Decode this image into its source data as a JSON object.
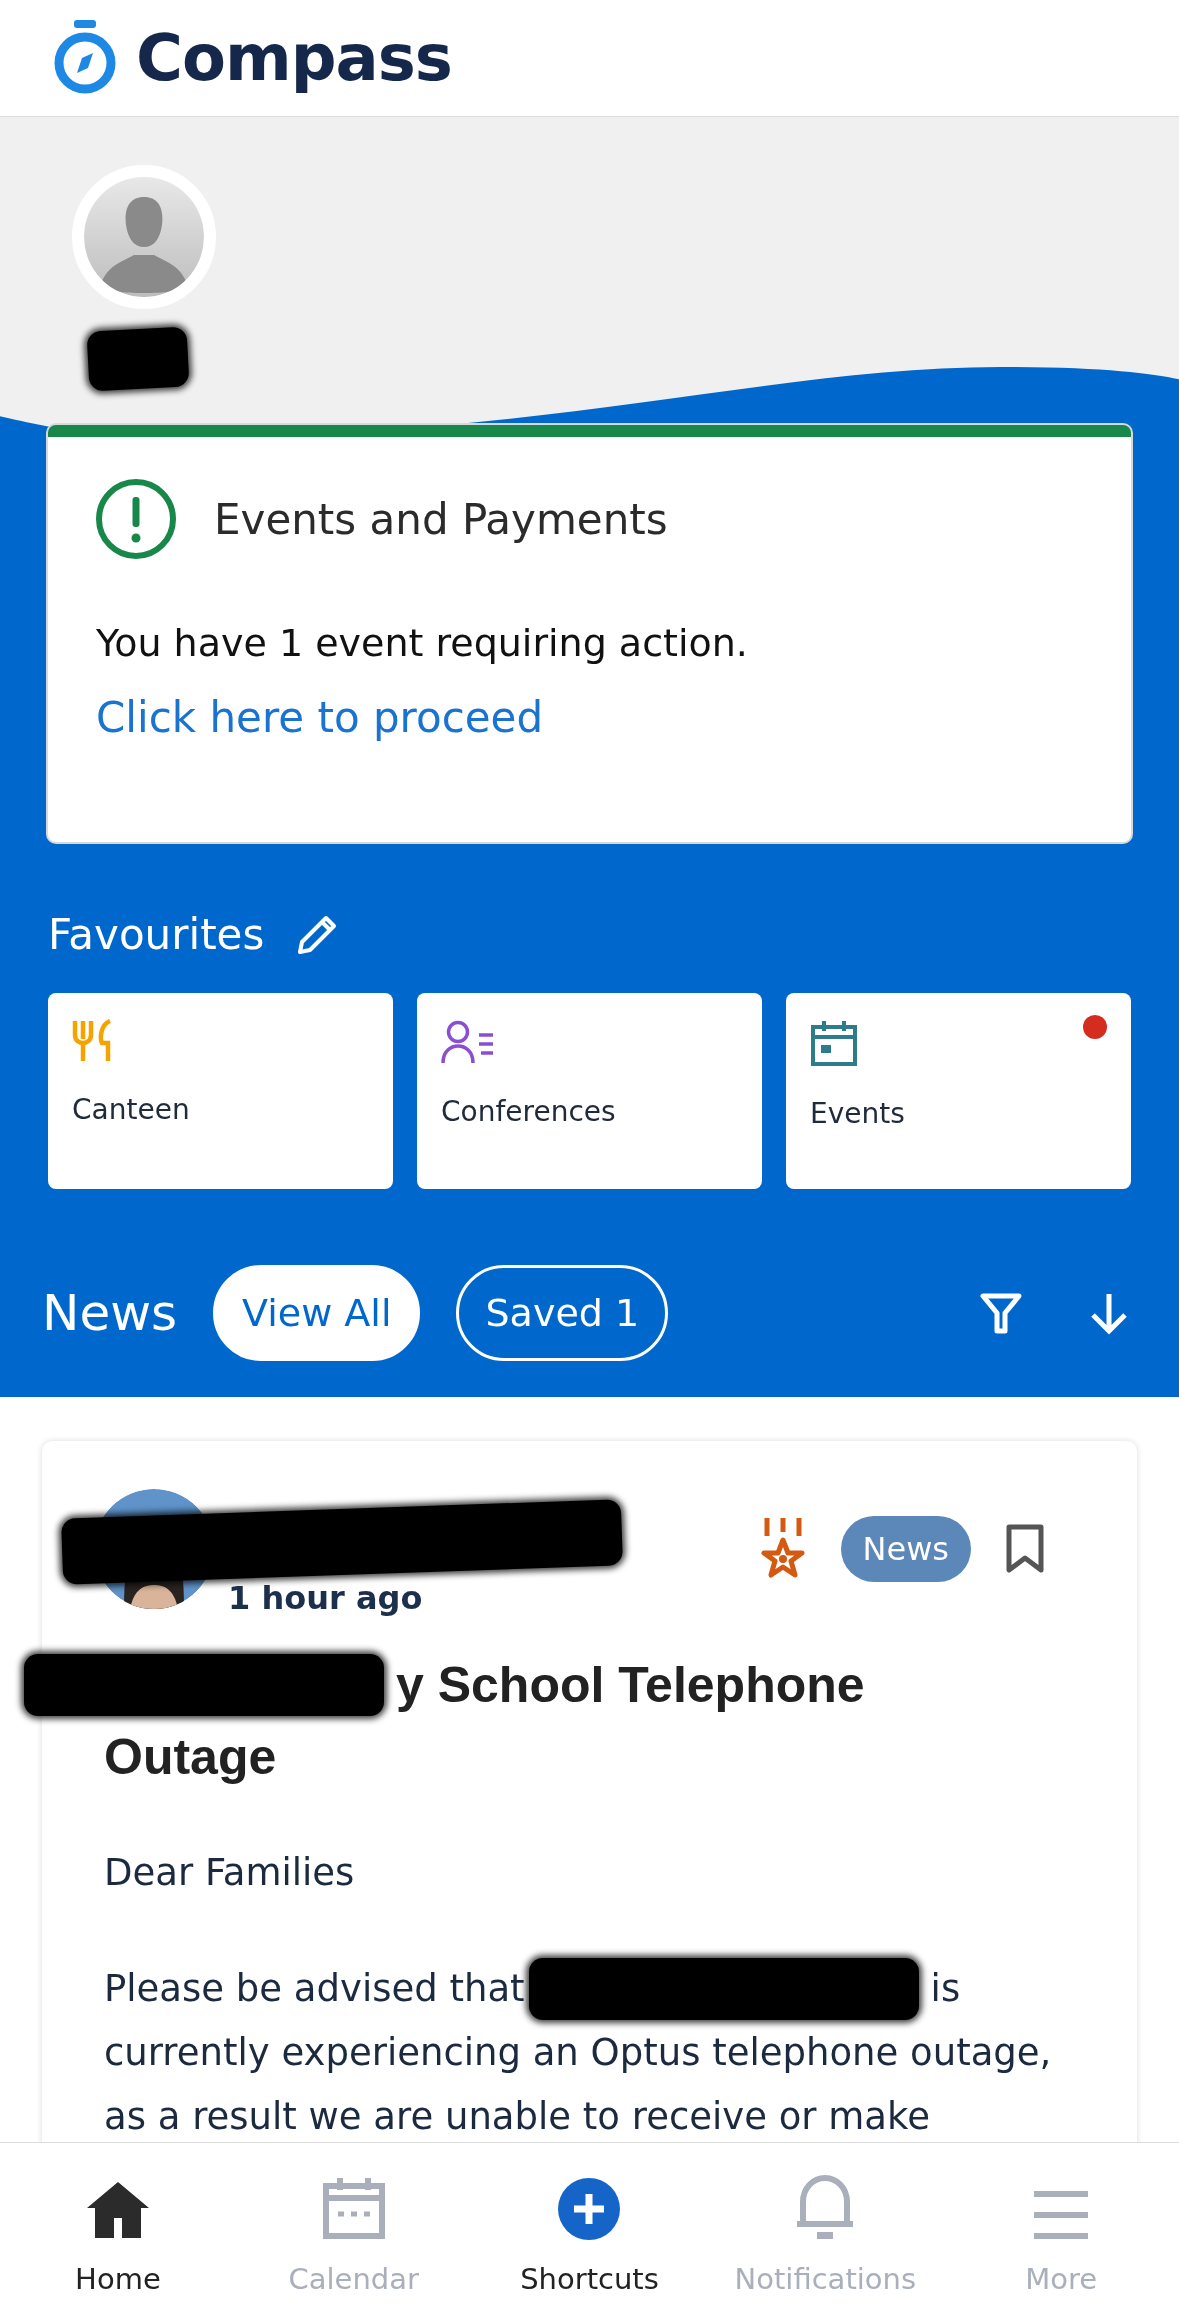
{
  "app": {
    "logo": "Compass"
  },
  "alert_card": {
    "title": "Events and Payments",
    "message": "You have 1 event requiring action.",
    "link": "Click here to proceed"
  },
  "favourites": {
    "title": "Favourites",
    "tiles": [
      {
        "label": "Canteen",
        "kind": "canteen",
        "alert": false
      },
      {
        "label": "Conferences",
        "kind": "conferences",
        "alert": false
      },
      {
        "label": "Events",
        "kind": "events",
        "alert": true
      }
    ]
  },
  "news": {
    "title": "News",
    "filters": [
      {
        "label": "View All",
        "selected": true
      },
      {
        "label": "Saved 1",
        "selected": false
      }
    ]
  },
  "post": {
    "time": "1 hour ago",
    "badge": "News",
    "title": "y School Telephone",
    "title_end": "Outage",
    "greeting": "Dear Families",
    "body_start": "Please be advised that",
    "body_after": "is",
    "body_rest": "currently experiencing an Optus telephone outage, as a result we are unable to receive or make"
  },
  "nav": [
    {
      "label": "Home",
      "kind": "home",
      "dimmed": false
    },
    {
      "label": "Calendar",
      "kind": "calendar",
      "dimmed": true
    },
    {
      "label": "Shortcuts",
      "kind": "shortcuts",
      "dimmed": false
    },
    {
      "label": "Notifications",
      "kind": "notifications",
      "dimmed": true
    },
    {
      "label": "More",
      "kind": "more",
      "dimmed": true
    }
  ]
}
